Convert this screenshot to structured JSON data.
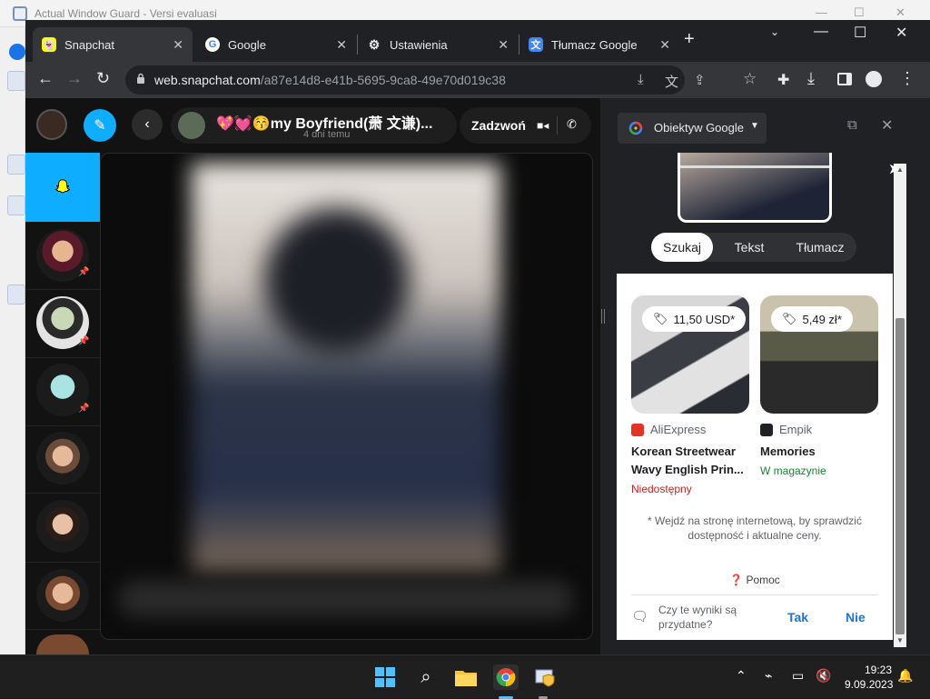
{
  "background_app": {
    "title": "Actual Window Guard - Versi evaluasi"
  },
  "browser": {
    "tabs": [
      {
        "label": "Snapchat",
        "favicon": "snapchat-icon",
        "active": true
      },
      {
        "label": "Google",
        "favicon": "google-icon",
        "active": false
      },
      {
        "label": "Ustawienia",
        "favicon": "gear-icon",
        "active": false
      },
      {
        "label": "Tłumacz Google",
        "favicon": "translate-icon",
        "active": false
      }
    ],
    "new_tab": "+",
    "url_domain": "web.snapchat.com",
    "url_path": "/a87e14d8-e41b-5695-9ca8-49e70d019c38"
  },
  "snapchat": {
    "chat_title": "💖💓😚my Boyfriend(萧 文谦)...",
    "chat_time": "4 dni temu",
    "call_label": "Zadzwoń",
    "accent": "#0fadff"
  },
  "lens": {
    "selector_label": "Obiektyw Google",
    "segments": [
      "Szukaj",
      "Tekst",
      "Tłumacz"
    ],
    "active_segment": "Szukaj",
    "products": [
      {
        "price": "11,50 USD*",
        "merchant": "AliExpress",
        "title": "Korean Streetwear Wavy English Prin...",
        "availability": "Niedostępny",
        "availability_color": "#c5221f"
      },
      {
        "price": "5,49 zł*",
        "merchant": "Empik",
        "title": "Memories",
        "availability": "W magazynie",
        "availability_color": "#188038"
      }
    ],
    "note": "* Wejdź na stronę internetową, by sprawdzić dostępność i aktualne ceny.",
    "help": "Pomoc",
    "feedback_question": "Czy te wyniki są przydatne?",
    "feedback_yes": "Tak",
    "feedback_no": "Nie"
  },
  "taskbar": {
    "time": "19:23",
    "date": "9.09.2023"
  }
}
